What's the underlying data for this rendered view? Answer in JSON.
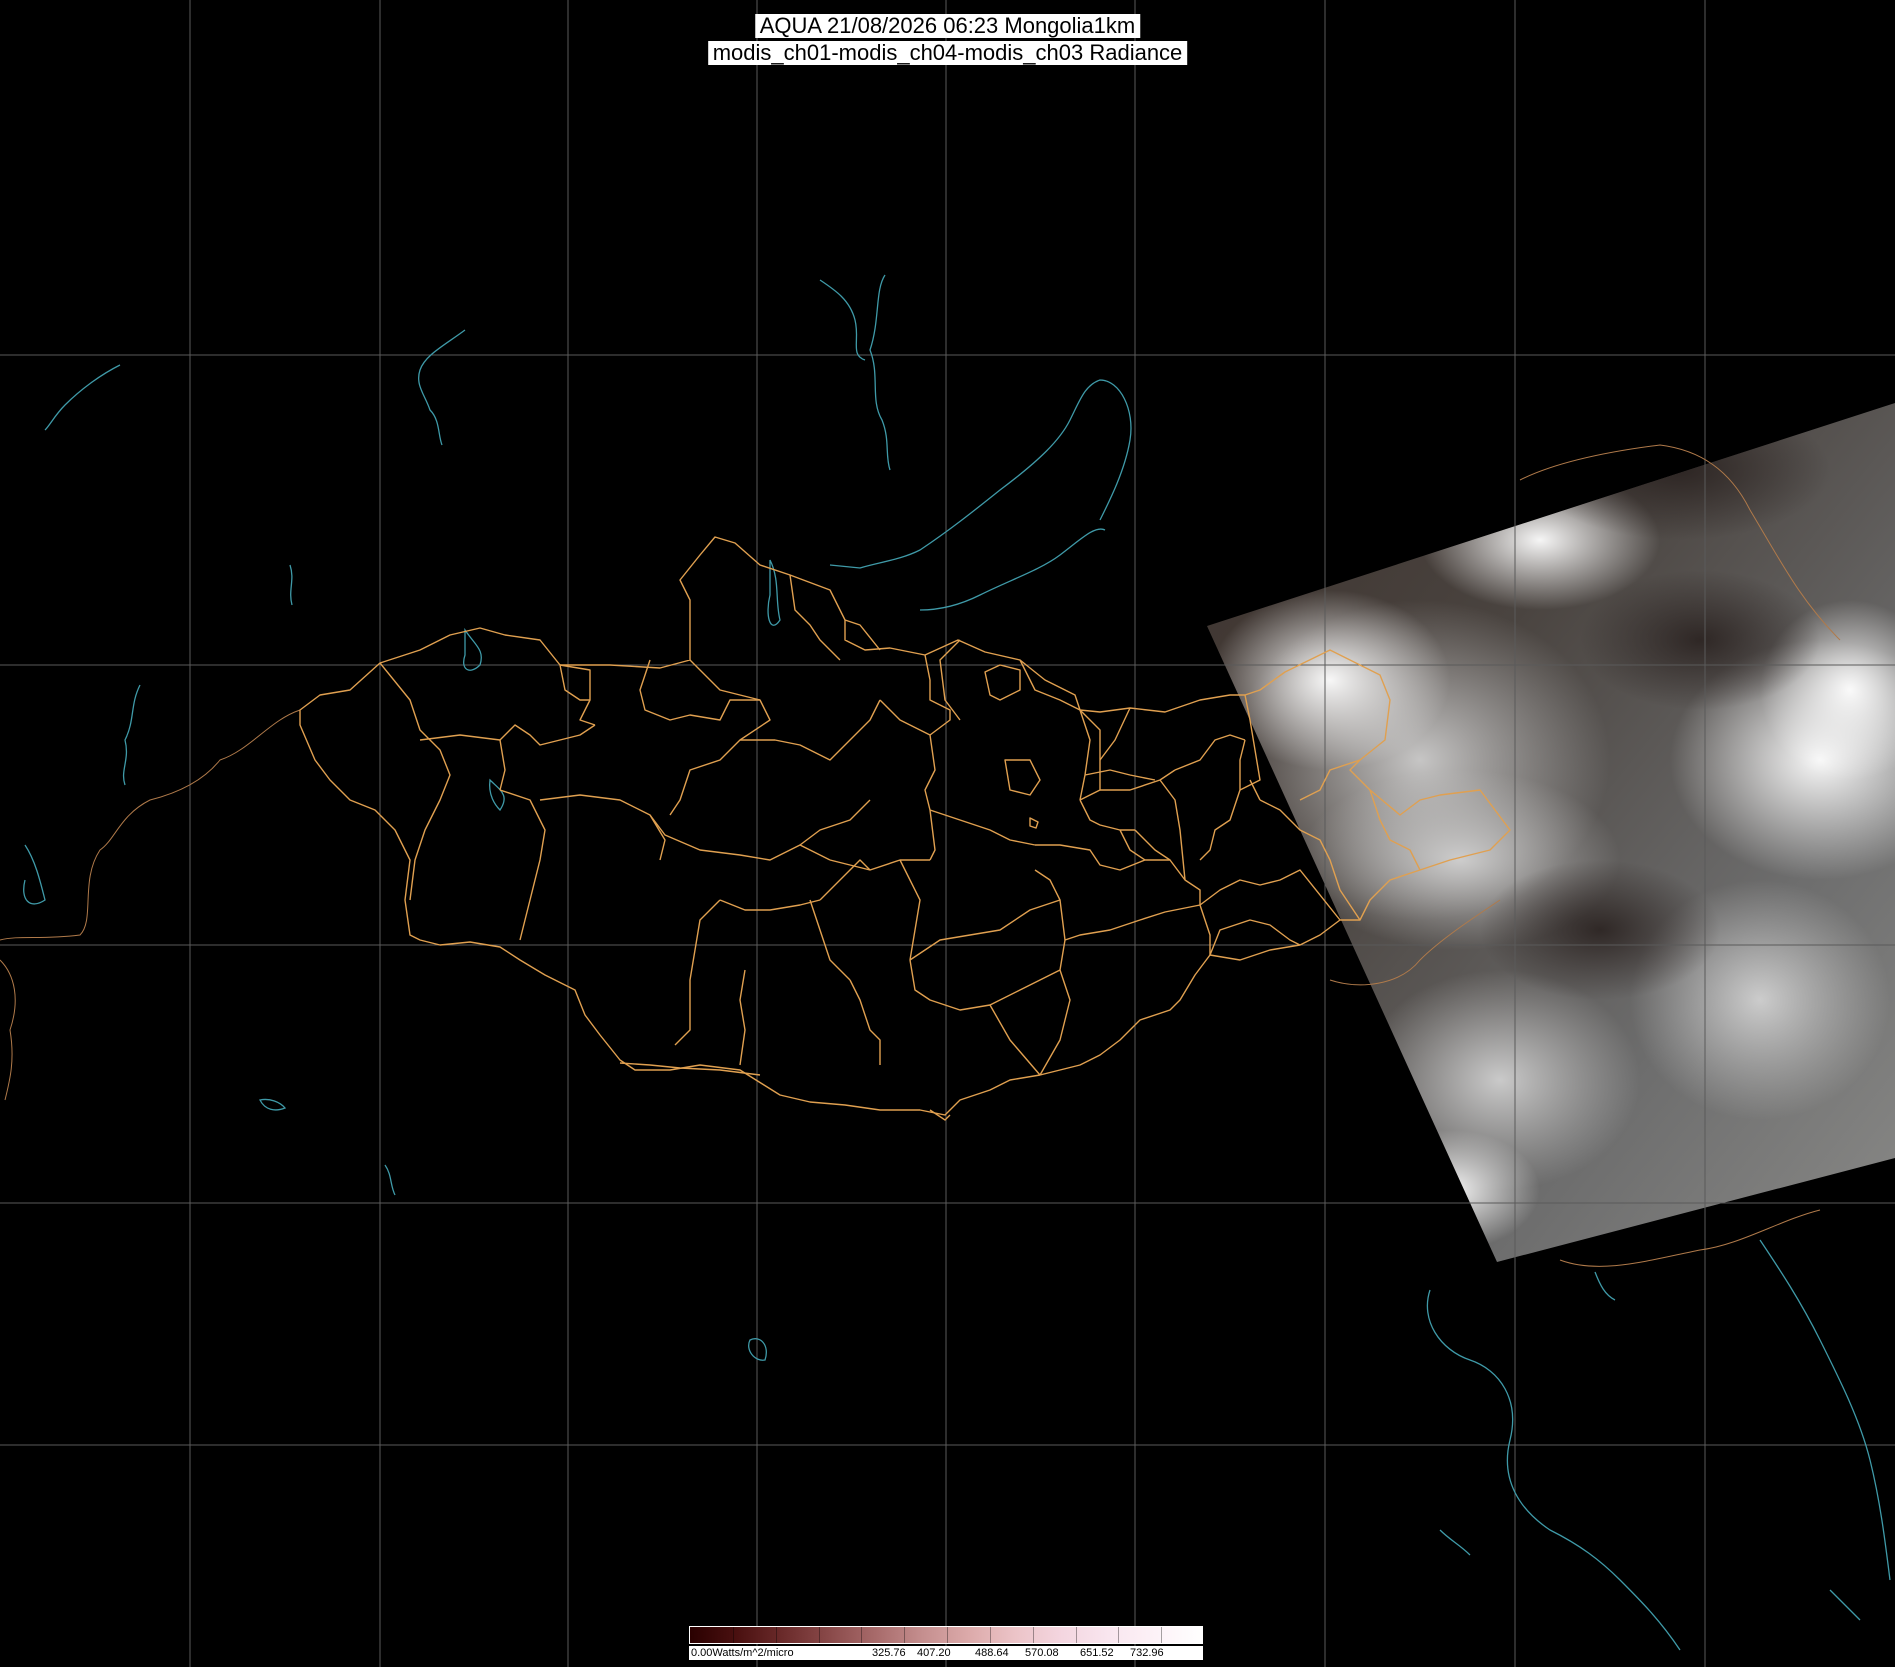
{
  "title": {
    "line1": "AQUA 21/08/2026 06:23 Mongolia1km",
    "line2": "modis_ch01-modis_ch04-modis_ch03 Radiance"
  },
  "legend": {
    "unit_label": "0.00Watts/m^2/micro",
    "ticks": [
      "325.76",
      "407.20",
      "488.64",
      "570.08",
      "651.52",
      "732.96"
    ],
    "colors": [
      "#2a0000",
      "#4a1010",
      "#6b2b2b",
      "#8a4a4a",
      "#a86b6b",
      "#c58f8f",
      "#dcaaaa",
      "#ecc4c8",
      "#f4d6e0",
      "#f9e6ef",
      "#fdf2f7",
      "#ffffff"
    ]
  },
  "map": {
    "background": "#000000",
    "graticule_color": "#5a5a5a",
    "admin_border_color": "#e0a050",
    "coast_water_color": "#3f9aa8",
    "country_border_color": "#b07a4a"
  }
}
